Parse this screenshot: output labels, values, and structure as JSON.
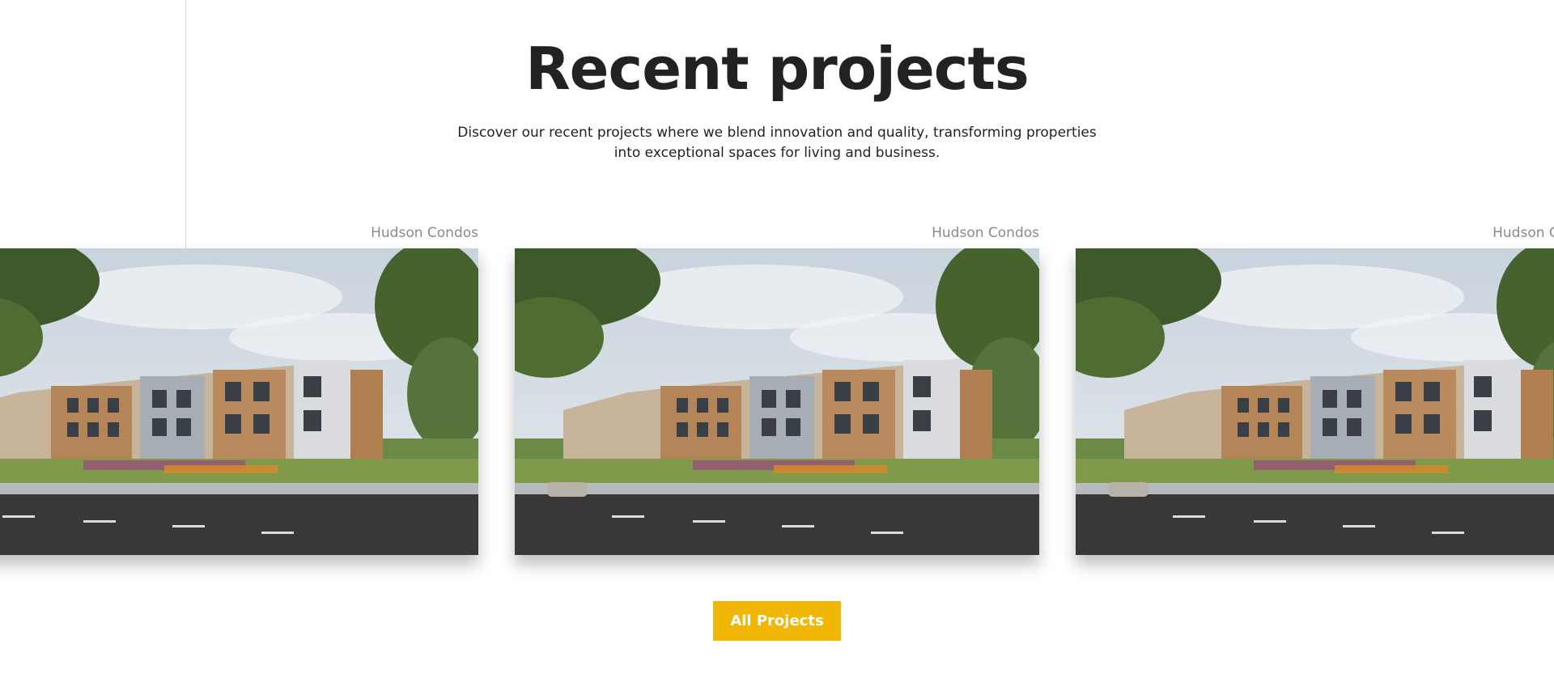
{
  "section": {
    "title": "Recent projects",
    "description": "Discover our recent projects where we blend innovation and quality, transforming properties into exceptional spaces for living and business."
  },
  "projects": [
    {
      "name": "Hudson Condos",
      "image": "condo-building-photo"
    },
    {
      "name": "Hudson Condos",
      "image": "condo-building-photo"
    },
    {
      "name": "Hudson Condos",
      "image": "condo-building-photo"
    }
  ],
  "cta": {
    "label": "All Projects"
  },
  "colors": {
    "accent": "#f2b705",
    "text": "#222222",
    "muted": "#8a8a8a",
    "divider": "#d7d7d7"
  }
}
